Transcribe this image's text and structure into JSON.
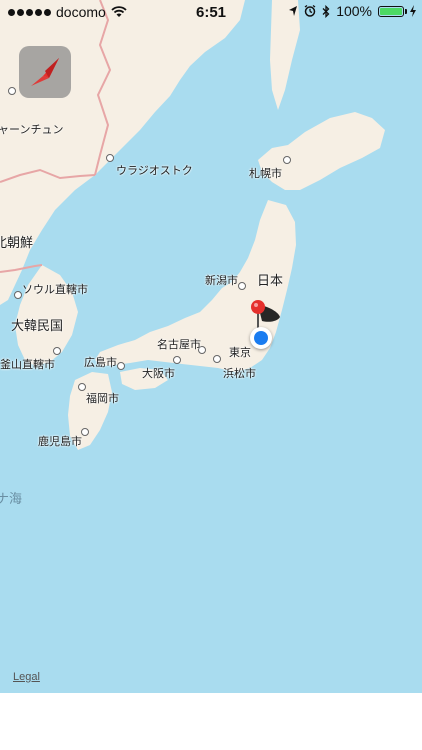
{
  "status_bar": {
    "carrier": "docomo",
    "time": "6:51",
    "battery": "100%"
  },
  "map": {
    "labels": {
      "khabarovsk_partial": "ャーンチュン",
      "vladivostok": "ウラジオストク",
      "sapporo": "札幌市",
      "north_korea_partial": "北朝鮮",
      "niigata": "新潟市",
      "japan": "日本",
      "seoul": "ソウル直轄市",
      "south_korea": "大韓民国",
      "nagoya": "名古屋市",
      "busan": "釜山直轄市",
      "hiroshima": "広島市",
      "tokyo": "東京",
      "osaka": "大阪市",
      "hamamatsu": "浜松市",
      "fukuoka": "福岡市",
      "kagoshima": "鹿児島市",
      "sea_partial": "ナ海"
    },
    "legal": "Legal"
  },
  "colors": {
    "water": "#a9dcef",
    "land": "#f6efe4",
    "pin": "#e5302d",
    "user_location": "#1a7cf0",
    "battery": "#4cd964"
  }
}
